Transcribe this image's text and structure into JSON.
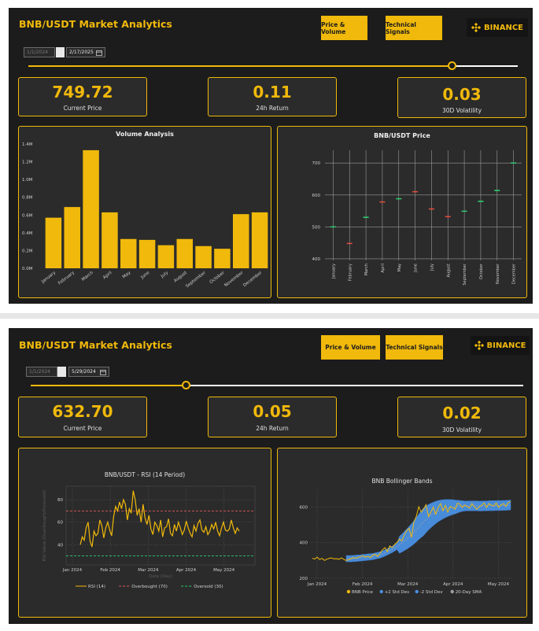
{
  "app": {
    "title": "BNB/USDT Market Analytics",
    "buttons": {
      "price_volume": "Price & Volume",
      "technical_signals": "Technical Signals"
    },
    "logo_text": "BINANCE"
  },
  "colors": {
    "accent": "#f0b90b",
    "panel_bg": "#1c1c1c",
    "card_bg": "#2b2b2b",
    "band_blue": "#4a90e2",
    "up_green": "#2ecc71",
    "down_red": "#e74c3c"
  },
  "dashboard_1": {
    "date_range": {
      "start_placeholder": "1/1/2024",
      "end": "2/17/2025"
    },
    "slider_position": 0.92,
    "kpis": [
      {
        "value": "749.72",
        "label": "Current Price"
      },
      {
        "value": "0.11",
        "label": "24h Return"
      },
      {
        "value": "0.03",
        "label": "30D Volatility"
      }
    ],
    "volume_chart": {
      "title": "Volume Analysis",
      "categories": [
        "January",
        "February",
        "March",
        "April",
        "May",
        "June",
        "July",
        "August",
        "September",
        "October",
        "November",
        "December"
      ],
      "values": [
        0.57,
        0.69,
        1.33,
        0.63,
        0.33,
        0.32,
        0.26,
        0.33,
        0.25,
        0.22,
        0.61,
        0.63
      ],
      "y_ticks": [
        "0.0M",
        "0.2M",
        "0.4M",
        "0.6M",
        "0.8M",
        "1.0M",
        "1.2M",
        "1.4M"
      ],
      "ylim": [
        0,
        1.4
      ]
    },
    "price_chart": {
      "title": "BNB/USDT Price",
      "categories": [
        "January",
        "February",
        "March",
        "April",
        "May",
        "June",
        "July",
        "August",
        "September",
        "October",
        "November",
        "December"
      ],
      "candles": [
        {
          "open": 500,
          "close": 502
        },
        {
          "open": 450,
          "close": 448
        },
        {
          "open": 528,
          "close": 532
        },
        {
          "open": 580,
          "close": 578
        },
        {
          "open": 588,
          "close": 590
        },
        {
          "open": 612,
          "close": 610
        },
        {
          "open": 558,
          "close": 556
        },
        {
          "open": 534,
          "close": 532
        },
        {
          "open": 549,
          "close": 551
        },
        {
          "open": 578,
          "close": 582
        },
        {
          "open": 612,
          "close": 616
        },
        {
          "open": 700,
          "close": 702
        }
      ],
      "y_ticks": [
        "400",
        "500",
        "600",
        "700"
      ],
      "ylim": [
        395,
        740
      ]
    }
  },
  "dashboard_2": {
    "date_range": {
      "start_placeholder": "1/1/2024",
      "end": "5/29/2024"
    },
    "slider_position": 0.31,
    "kpis": [
      {
        "value": "632.70",
        "label": "Current Price"
      },
      {
        "value": "0.05",
        "label": "24h Return"
      },
      {
        "value": "0.02",
        "label": "30D Volatility"
      }
    ],
    "rsi_chart": {
      "title": "BNB/USDT - RSI (14 Period)",
      "y_ticks": [
        "40",
        "60",
        "80"
      ],
      "x_ticks": [
        "Jan 2024",
        "Feb 2024",
        "Mar 2024",
        "Apr 2024",
        "May 2024"
      ],
      "ylabel": "RSI Value (Overbought/Oversold)",
      "xlabel": "Date (Day)",
      "legend": [
        "RSI (14)",
        "Overbought (70)",
        "Oversold (30)"
      ],
      "overbought": 70,
      "oversold": 30,
      "ylim": [
        22,
        92
      ],
      "values": [
        40,
        47,
        44,
        55,
        60,
        43,
        38,
        52,
        48,
        50,
        62,
        57,
        46,
        55,
        60,
        53,
        48,
        65,
        74,
        70,
        78,
        72,
        80,
        76,
        62,
        72,
        68,
        88,
        80,
        66,
        72,
        60,
        76,
        64,
        58,
        66,
        54,
        49,
        60,
        57,
        52,
        62,
        47,
        55,
        56,
        63,
        50,
        48,
        58,
        52,
        60,
        55,
        49,
        53,
        61,
        55,
        50,
        47,
        57,
        52,
        59,
        62,
        53,
        51,
        56,
        49,
        52,
        58,
        54,
        60,
        52,
        48,
        55,
        60,
        53,
        52,
        54,
        62,
        55,
        50,
        55,
        52
      ]
    },
    "bollinger_chart": {
      "title": "BNB Bollinger Bands",
      "y_ticks": [
        "200",
        "400",
        "600"
      ],
      "x_ticks": [
        "Jan 2024",
        "Feb 2024",
        "Mar 2024",
        "Apr 2024",
        "May 2024"
      ],
      "legend": [
        "BNB Price",
        "+2 Std Dev",
        "-2 Std Dev",
        "20-Day SMA"
      ],
      "ylim": [
        195,
        700
      ],
      "price": [
        312,
        308,
        318,
        305,
        312,
        300,
        307,
        312,
        314,
        308,
        310,
        306,
        314,
        306,
        300,
        304,
        310,
        316,
        312,
        318,
        322,
        326,
        318,
        324,
        316,
        330,
        334,
        322,
        340,
        360,
        372,
        350,
        382,
        372,
        390,
        402,
        420,
        410,
        444,
        468,
        480,
        430,
        518,
        548,
        602,
        572,
        590,
        614,
        548,
        572,
        600,
        560,
        596,
        620,
        580,
        610,
        572,
        604,
        598,
        588,
        622,
        616,
        598,
        612,
        604,
        595,
        620,
        602,
        588,
        602,
        610,
        624,
        598,
        620,
        612,
        606,
        624,
        598,
        612,
        620,
        604,
        626,
        632
      ],
      "sma": [
        320,
        318,
        317,
        316,
        315,
        314,
        313,
        312,
        312,
        311,
        311,
        311,
        311,
        310,
        310,
        310,
        310,
        311,
        312,
        313,
        314,
        316,
        317,
        319,
        320,
        322,
        325,
        328,
        331,
        336,
        342,
        348,
        355,
        362,
        370,
        379,
        388,
        398,
        409,
        420,
        432,
        444,
        458,
        473,
        489,
        504,
        518,
        531,
        543,
        553,
        562,
        570,
        577,
        583,
        588,
        592,
        595,
        598,
        600,
        601,
        603,
        605,
        606,
        606,
        607,
        607,
        607,
        607,
        607,
        606,
        606,
        607,
        607,
        608,
        608,
        608,
        609,
        609,
        609,
        610,
        610,
        611,
        612
      ]
    }
  }
}
